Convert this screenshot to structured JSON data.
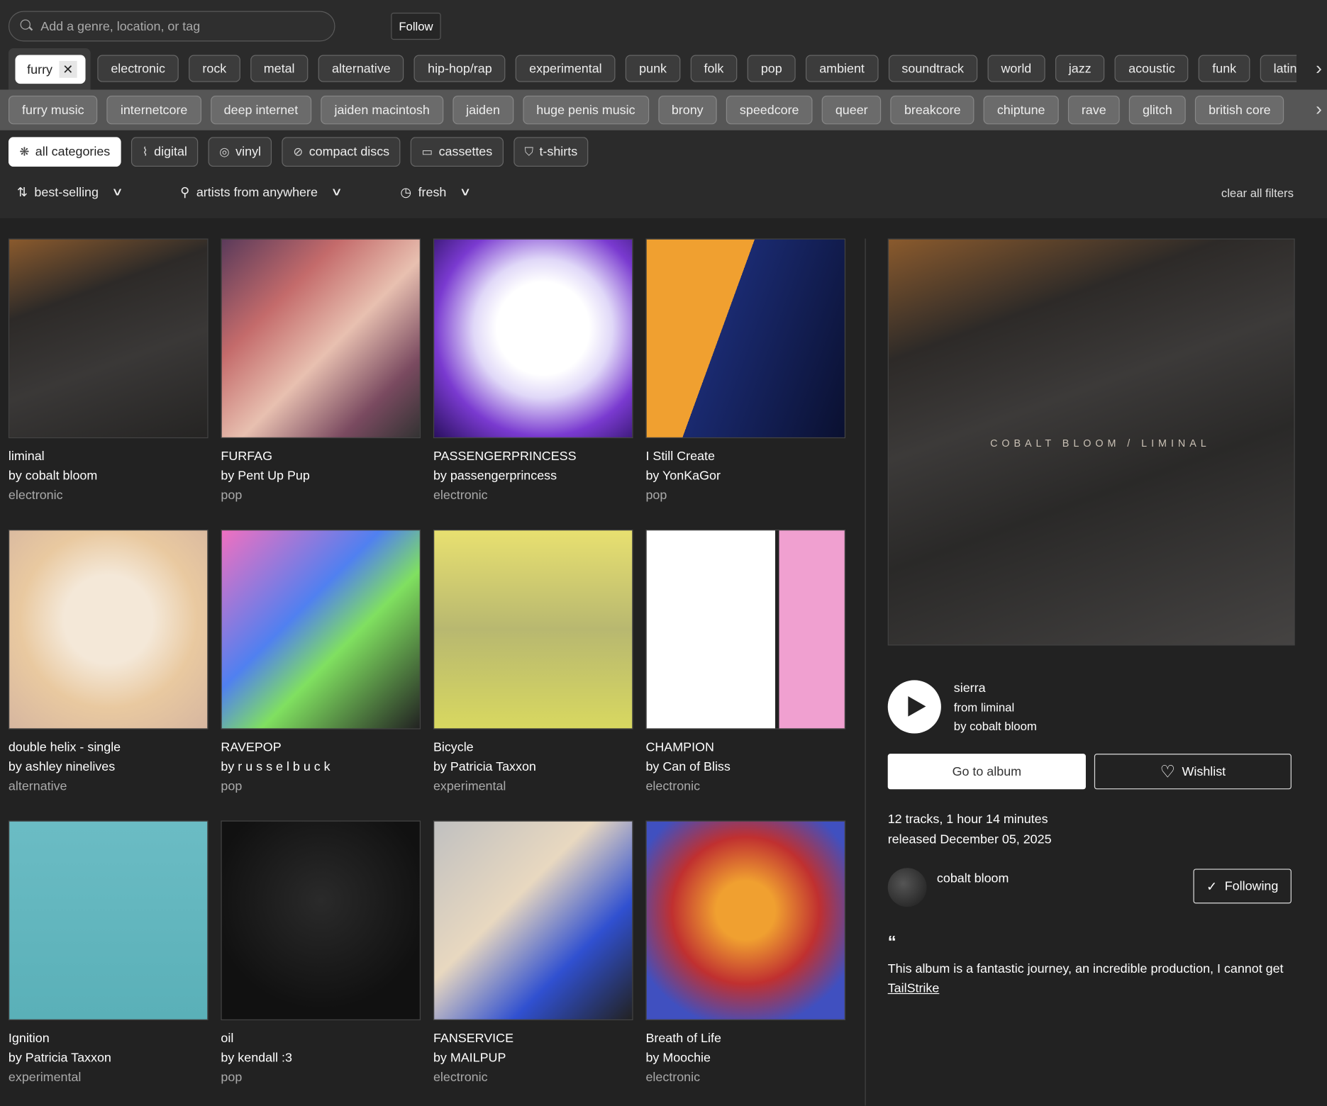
{
  "search": {
    "placeholder": "Add a genre, location, or tag",
    "follow_label": "Follow"
  },
  "active_tag": {
    "label": "furry",
    "remove": "✕"
  },
  "genre_tags": [
    "electronic",
    "rock",
    "metal",
    "alternative",
    "hip-hop/rap",
    "experimental",
    "punk",
    "folk",
    "pop",
    "ambient",
    "soundtrack",
    "world",
    "jazz",
    "acoustic",
    "funk",
    "latin"
  ],
  "related_tags": [
    "furry music",
    "internetcore",
    "deep internet",
    "jaiden macintosh",
    "jaiden",
    "huge penis music",
    "brony",
    "speedcore",
    "queer",
    "breakcore",
    "chiptune",
    "rave",
    "glitch",
    "british core"
  ],
  "categories": [
    {
      "label": "all categories",
      "icon": "burst-icon",
      "selected": true
    },
    {
      "label": "digital",
      "icon": "waveform-icon"
    },
    {
      "label": "vinyl",
      "icon": "vinyl-icon"
    },
    {
      "label": "compact discs",
      "icon": "cd-icon"
    },
    {
      "label": "cassettes",
      "icon": "cassette-icon"
    },
    {
      "label": "t-shirts",
      "icon": "tshirt-icon"
    }
  ],
  "sort": {
    "order": "best-selling",
    "location": "artists from anywhere",
    "time": "fresh",
    "clear": "clear all filters"
  },
  "albums": [
    {
      "title": "liminal",
      "artist": "by cobalt bloom",
      "genre": "electronic",
      "art": "linear-gradient(160deg,#8a5a2d,#2d2a28 30%,#3a3837 60%,#252423)"
    },
    {
      "title": "FURFAG",
      "artist": "by Pent Up Pup",
      "genre": "pop",
      "art": "linear-gradient(135deg,#5a3a5a,#c46b6b 30%,#e8c0b0 55%,#7a4a60 80%,#333)"
    },
    {
      "title": "PASSENGERPRINCESS",
      "artist": "by passengerprincess",
      "genre": "electronic",
      "art": "radial-gradient(circle at 55% 45%,#fff 30%,#e0d8f8 45%,#7a3ad0 70%,#2a1060)"
    },
    {
      "title": "I Still Create",
      "artist": "by YonKaGor",
      "genre": "pop",
      "art": "linear-gradient(110deg,#f0a030 40%,#1a2a70 40%,#0a1030)"
    },
    {
      "title": "double helix - single",
      "artist": "by ashley ninelives",
      "genre": "alternative",
      "art": "radial-gradient(circle at 50% 45%,#f4e8d8 30%,#e9c9a0 60%,#d6b6a0)"
    },
    {
      "title": "RAVEPOP",
      "artist": "by r u s s e l b u c k",
      "genre": "pop",
      "art": "linear-gradient(135deg,#f070c0,#5080f0 40%,#80e060 60%,#222)"
    },
    {
      "title": "Bicycle",
      "artist": "by Patricia Taxxon",
      "genre": "experimental",
      "art": "linear-gradient(180deg,#e8e070,#b8b870 50%,#d8d860)"
    },
    {
      "title": "CHAMPION",
      "artist": "by Can of Bliss",
      "genre": "electronic",
      "art": "linear-gradient(90deg,#fff 65%,#222 65%,#222 67%,#f0a0d0 67%)"
    },
    {
      "title": "Ignition",
      "artist": "by Patricia Taxxon",
      "genre": "experimental",
      "art": "linear-gradient(180deg,#6bbcc4,#5ab0b8)"
    },
    {
      "title": "oil",
      "artist": "by kendall :3",
      "genre": "pop",
      "art": "radial-gradient(circle at 50% 40%,#2a2a2a,#111 70%)"
    },
    {
      "title": "FANSERVICE",
      "artist": "by MAILPUP",
      "genre": "electronic",
      "art": "linear-gradient(135deg,#c0c0c0,#e8d8c0 40%,#3050d0 70%,#222)"
    },
    {
      "title": "Breath of Life",
      "artist": "by Moochie",
      "genre": "electronic",
      "art": "radial-gradient(circle at 50% 45%,#f0a030 20%,#c03030 50%,#4050c0 80%)"
    }
  ],
  "featured": {
    "art_text": "COBALT BLOOM / LIMINAL",
    "track": "sierra",
    "from": "from liminal",
    "by": "by cobalt bloom",
    "go_to_album": "Go to album",
    "wishlist": "Wishlist",
    "tracks_info": "12 tracks, 1 hour 14 minutes",
    "released": "released December 05, 2025",
    "artist_name": "cobalt bloom",
    "following": "Following",
    "quote_mark": "“",
    "review": "This album is a fantastic journey, an incredible production, I cannot get",
    "reviewer": "TailStrike"
  }
}
